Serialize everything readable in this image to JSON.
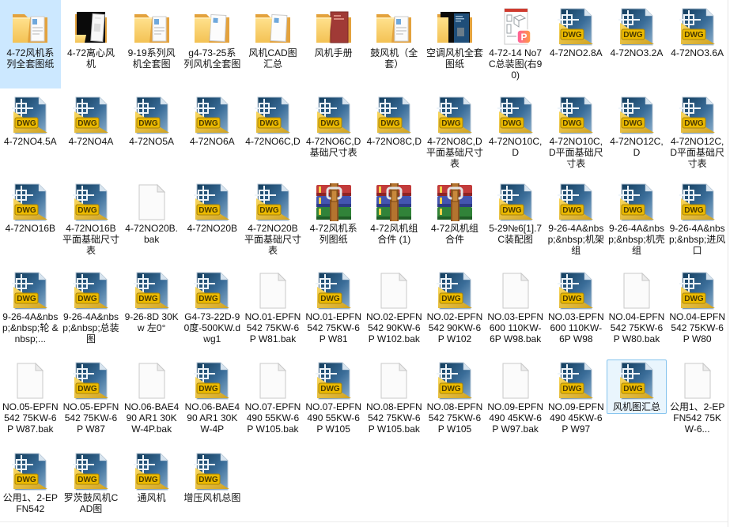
{
  "window": {
    "background": "#ffffff",
    "edge_line_color": "#e6e6e6"
  },
  "selection": {
    "selected_fill": "#cce8ff",
    "hover_fill": "#e9f5fd",
    "hover_border": "#84c3ee"
  },
  "icon_colors": {
    "folder_front_yellow": "#f8d06b",
    "folder_back_yellow": "#e3a23d",
    "dwg_page_blue": "#3a6d99",
    "dwg_ribbon_gold": "#e9bc17",
    "dwg_text_brown": "#4a3a00",
    "rar_book_red": "#c23b3b",
    "rar_book_blue": "#4455b0",
    "rar_book_green": "#318339",
    "rar_strap_brown": "#b4742f",
    "bak_page_white": "#fbfbfb",
    "preview_badge_pink": "#ff5d9e",
    "preview_badge_orange": "#ff9b41",
    "handbook_red": "#a03a36",
    "catalog_book_navy": "#1f4e79",
    "black_preview": "#0a0a0a"
  },
  "items": [
    {
      "icon": "folder-docs",
      "label": "4-72风机系列全套图纸",
      "state": "selected"
    },
    {
      "icon": "folder-black-preview",
      "label": "4-72离心风机"
    },
    {
      "icon": "folder-docs",
      "label": "9-19系列风机全套图"
    },
    {
      "icon": "folder-page",
      "label": "g4-73-25系列风机全套图"
    },
    {
      "icon": "folder-page",
      "label": "风机CAD图汇总"
    },
    {
      "icon": "folder-handbook",
      "label": "风机手册"
    },
    {
      "icon": "folder-docs",
      "label": "鼓风机（全套）"
    },
    {
      "icon": "folder-book-preview",
      "label": "空调风机全套图纸"
    },
    {
      "icon": "drawing-preview",
      "label": "4-72-14 No7C总装图(右90)"
    },
    {
      "icon": "dwg-file",
      "label": "4-72NO2.8A"
    },
    {
      "icon": "dwg-file",
      "label": "4-72NO3.2A"
    },
    {
      "icon": "dwg-file",
      "label": "4-72NO3.6A"
    },
    {
      "icon": "dwg-file",
      "label": "4-72NO4.5A"
    },
    {
      "icon": "dwg-file",
      "label": "4-72NO4A"
    },
    {
      "icon": "dwg-file",
      "label": "4-72NO5A"
    },
    {
      "icon": "dwg-file",
      "label": "4-72NO6A"
    },
    {
      "icon": "dwg-file",
      "label": "4-72NO6C,D"
    },
    {
      "icon": "dwg-file",
      "label": "4-72NO6C,D基础尺寸表"
    },
    {
      "icon": "dwg-file",
      "label": "4-72NO8C,D"
    },
    {
      "icon": "dwg-file",
      "label": "4-72NO8C,D平面基础尺寸表"
    },
    {
      "icon": "dwg-file",
      "label": "4-72NO10C,D"
    },
    {
      "icon": "dwg-file",
      "label": "4-72NO10C,D平面基础尺寸表"
    },
    {
      "icon": "dwg-file",
      "label": "4-72NO12C,D"
    },
    {
      "icon": "dwg-file",
      "label": "4-72NO12C,D平面基础尺寸表"
    },
    {
      "icon": "dwg-file",
      "label": "4-72NO16B"
    },
    {
      "icon": "dwg-file",
      "label": "4-72NO16B平面基础尺寸表"
    },
    {
      "icon": "bak-file",
      "label": "4-72NO20B.bak"
    },
    {
      "icon": "dwg-file",
      "label": "4-72NO20B"
    },
    {
      "icon": "dwg-file",
      "label": "4-72NO20B平面基础尺寸表"
    },
    {
      "icon": "rar-archive",
      "label": "4-72风机系列图纸"
    },
    {
      "icon": "rar-archive",
      "label": "4-72风机组合件 (1)"
    },
    {
      "icon": "rar-archive",
      "label": "4-72风机组合件"
    },
    {
      "icon": "dwg-file",
      "label": "5-29№6[1].7C装配图"
    },
    {
      "icon": "dwg-file",
      "label": "9-26-4A&nbsp;&nbsp;机架组"
    },
    {
      "icon": "dwg-file",
      "label": "9-26-4A&nbsp;&nbsp;机壳组"
    },
    {
      "icon": "dwg-file",
      "label": "9-26-4A&nbsp;&nbsp;进风口"
    },
    {
      "icon": "dwg-file",
      "label": "9-26-4A&nbsp;&nbsp;轮 &nbsp;..."
    },
    {
      "icon": "dwg-file",
      "label": "9-26-4A&nbsp;&nbsp;总装图"
    },
    {
      "icon": "dwg-file",
      "label": "9-26-8D 30Kw 左0°"
    },
    {
      "icon": "dwg-file",
      "label": "G4-73-22D-90度-500KW.dwg1"
    },
    {
      "icon": "bak-file",
      "label": "NO.01-EPFN542 75KW-6P W81.bak"
    },
    {
      "icon": "dwg-file",
      "label": "NO.01-EPFN542 75KW-6P W81"
    },
    {
      "icon": "bak-file",
      "label": "NO.02-EPFN542 90KW-6P W102.bak"
    },
    {
      "icon": "dwg-file",
      "label": "NO.02-EPFN542 90KW-6P W102"
    },
    {
      "icon": "bak-file",
      "label": "NO.03-EPFN600 110KW-6P W98.bak"
    },
    {
      "icon": "dwg-file",
      "label": "NO.03-EPFN600 110KW-6P W98"
    },
    {
      "icon": "bak-file",
      "label": "NO.04-EPFN542 75KW-6P W80.bak"
    },
    {
      "icon": "dwg-file",
      "label": "NO.04-EPFN542 75KW-6P W80"
    },
    {
      "icon": "bak-file",
      "label": "NO.05-EPFN542 75KW-6P W87.bak"
    },
    {
      "icon": "dwg-file",
      "label": "NO.05-EPFN542 75KW-6P W87"
    },
    {
      "icon": "bak-file",
      "label": "NO.06-BAE490 AR1 30KW-4P.bak"
    },
    {
      "icon": "dwg-file",
      "label": "NO.06-BAE490 AR1 30KW-4P"
    },
    {
      "icon": "bak-file",
      "label": "NO.07-EPFN490 55KW-6P W105.bak"
    },
    {
      "icon": "dwg-file",
      "label": "NO.07-EPFN490 55KW-6P W105"
    },
    {
      "icon": "bak-file",
      "label": "NO.08-EPFN542 75KW-6P W105.bak"
    },
    {
      "icon": "dwg-file",
      "label": "NO.08-EPFN542 75KW-6P W105"
    },
    {
      "icon": "bak-file",
      "label": "NO.09-EPFN490 45KW-6P W97.bak"
    },
    {
      "icon": "dwg-file",
      "label": "NO.09-EPFN490 45KW-6P W97"
    },
    {
      "icon": "dwg-file",
      "label": "风机图汇总",
      "state": "hover"
    },
    {
      "icon": "bak-file",
      "label": "公用1、2-EPFN542 75KW-6..."
    },
    {
      "icon": "dwg-file",
      "label": "公用1、2-EPFN542"
    },
    {
      "icon": "dwg-file",
      "label": "罗茨鼓风机CAD图"
    },
    {
      "icon": "dwg-file",
      "label": "通风机"
    },
    {
      "icon": "dwg-file",
      "label": "增压风机总图"
    }
  ]
}
